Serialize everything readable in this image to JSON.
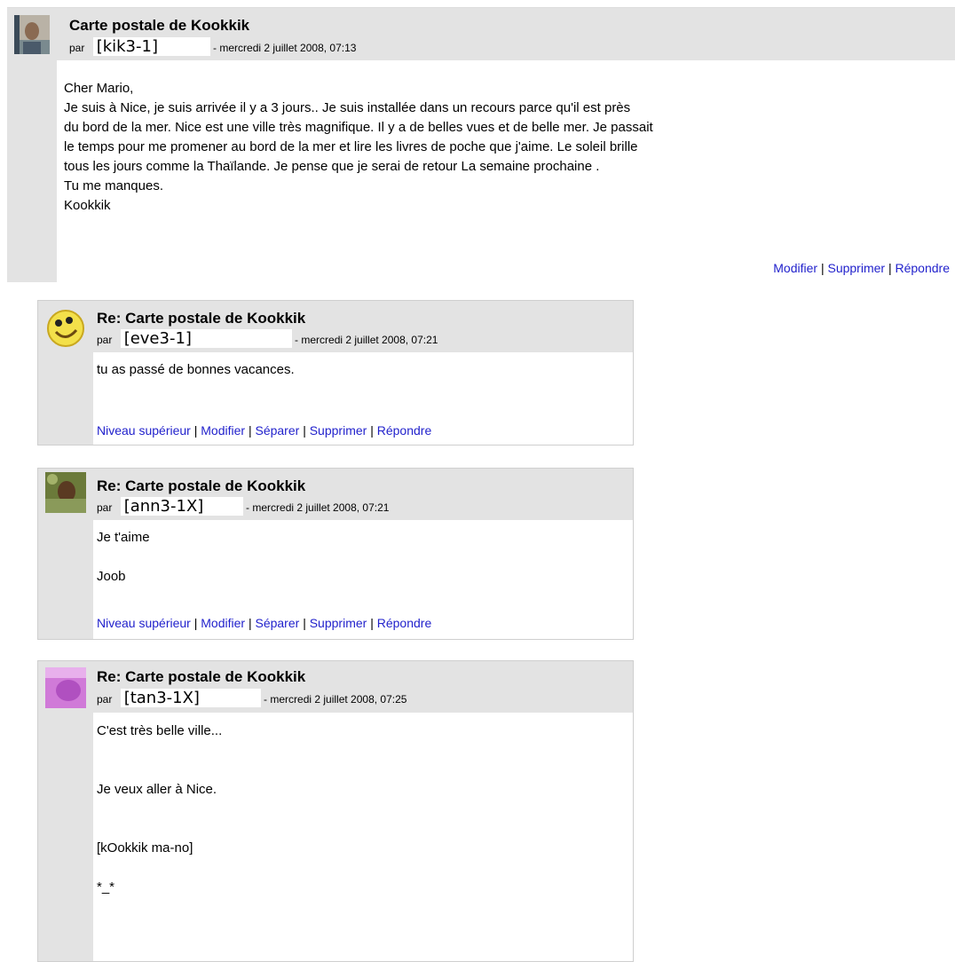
{
  "posts": [
    {
      "subject": "Carte postale de Kookkik",
      "par": "par",
      "author": "[kik3-1]",
      "date": "- mercredi 2 juillet 2008, 07:13",
      "lines": [
        "Cher Mario,",
        "Je suis à Nice, je suis arrivée il y a 3 jours.. Je suis installée dans un recours parce qu'il est près",
        "du bord de la mer. Nice est une ville très magnifique. Il y a de belles vues et de belle mer. Je passait",
        "le temps pour me promener au bord de la mer et lire les livres de poche que j'aime. Le soleil brille",
        "tous les jours comme la Thaïlande. Je pense que je serai de retour La semaine prochaine .",
        "Tu me manques.",
        "Kookkik"
      ],
      "commands": [
        "Modifier",
        "Supprimer",
        "Répondre"
      ]
    },
    {
      "subject": "Re: Carte postale de Kookkik",
      "par": "par",
      "author": "[eve3-1]",
      "date": "- mercredi 2 juillet 2008, 07:21",
      "lines": [
        "tu as passé de bonnes vacances."
      ],
      "commands": [
        "Niveau supérieur",
        "Modifier",
        "Séparer",
        "Supprimer",
        "Répondre"
      ]
    },
    {
      "subject": "Re: Carte postale de Kookkik",
      "par": "par",
      "author": "[ann3-1X]",
      "date": "- mercredi 2 juillet 2008, 07:21",
      "lines": [
        "Je t'aime",
        "Joob"
      ],
      "commands": [
        "Niveau supérieur",
        "Modifier",
        "Séparer",
        "Supprimer",
        "Répondre"
      ]
    },
    {
      "subject": "Re: Carte postale de Kookkik",
      "par": "par",
      "author": "[tan3-1X]",
      "date": "- mercredi 2 juillet 2008, 07:25",
      "lines": [
        "C'est très belle ville...",
        "Je veux aller à Nice.",
        "[kOokkik ma-no]",
        "*_*"
      ],
      "commands": []
    }
  ],
  "colors": {
    "link": "#2222cc",
    "header_bg": "#e3e3e3"
  },
  "icons": [
    "profile-photo-man",
    "smiley-face-avatar",
    "profile-photo-outdoor",
    "profile-photo-pink"
  ]
}
